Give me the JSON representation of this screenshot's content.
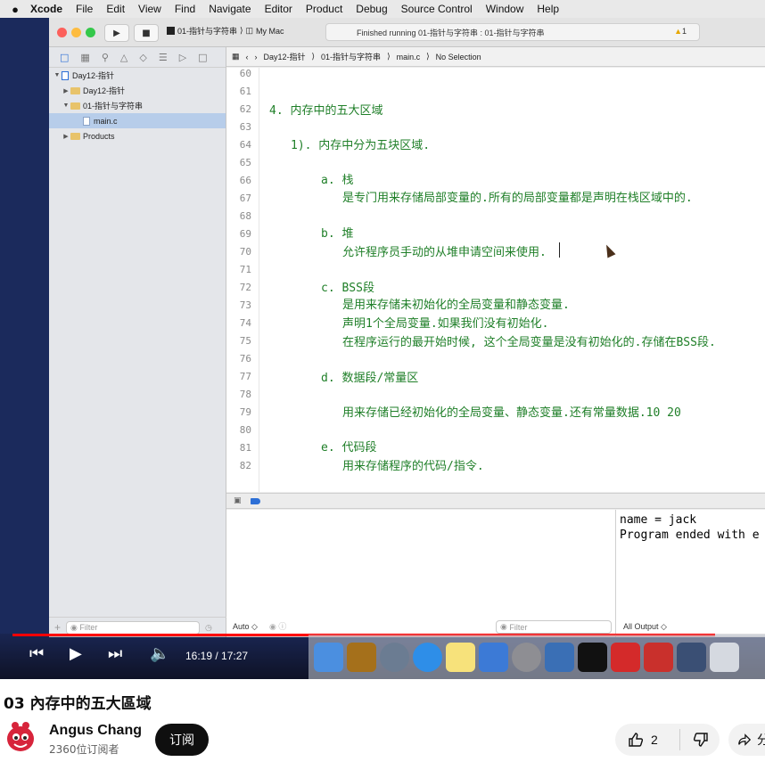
{
  "menubar": {
    "apple_icon": "apple-logo",
    "items": [
      "Xcode",
      "File",
      "Edit",
      "View",
      "Find",
      "Navigate",
      "Editor",
      "Product",
      "Debug",
      "Source Control",
      "Window",
      "Help"
    ]
  },
  "toolbar": {
    "scheme": "01-指针与字符串",
    "destination": "My Mac",
    "status": "Finished running 01-指针与字符串 : 01-指针与字符串",
    "warning_count": "1"
  },
  "navigator": {
    "items": [
      {
        "label": "Day12-指针"
      },
      {
        "label": "Day12-指针"
      },
      {
        "label": "01-指针与字符串"
      },
      {
        "label": "main.c"
      },
      {
        "label": "Products"
      }
    ],
    "filter_placeholder": "Filter"
  },
  "jumpbar": {
    "crumbs": [
      "Day12-指针",
      "01-指针与字符串",
      "main.c",
      "No Selection"
    ]
  },
  "editor": {
    "line_numbers": [
      "60",
      "61",
      "62",
      "63",
      "64",
      "65",
      "66",
      "67",
      "68",
      "69",
      "70",
      "71",
      "72",
      "73",
      "74",
      "75",
      "76",
      "77",
      "78",
      "79",
      "80",
      "81",
      "82"
    ],
    "lines": [
      "4. 内存中的五大区域",
      "1). 内存中分为五块区域.",
      "a. 栈",
      "是专门用来存储局部变量的.所有的局部变量都是声明在栈区域中的.",
      "b. 堆",
      "允许程序员手动的从堆申请空间来使用.",
      "c. BSS段",
      "是用来存储未初始化的全局变量和静态变量.",
      "声明1个全局变量.如果我们没有初始化.",
      "在程序运行的最开始时候, 这个全局变量是没有初始化的.存储在BSS段.",
      "d. 数据段/常量区",
      "用来存储已经初始化的全局变量、静态变量.还有常量数据.10 20",
      "e. 代码段",
      "用来存储程序的代码/指令."
    ]
  },
  "debug": {
    "console_output": "name = jack\nProgram ended with e",
    "auto_label": "Auto ◇",
    "filter_placeholder": "Filter",
    "all_output_label": "All Output ◇"
  },
  "player": {
    "time": "16:19 / 17:27",
    "progress": 0.934
  },
  "video": {
    "title": "03 內存中的五大區域",
    "channel": "Angus Chang",
    "subscribers": "2360位订阅者",
    "subscribe_label": "订阅",
    "likes": "2",
    "share_label": "分享"
  }
}
